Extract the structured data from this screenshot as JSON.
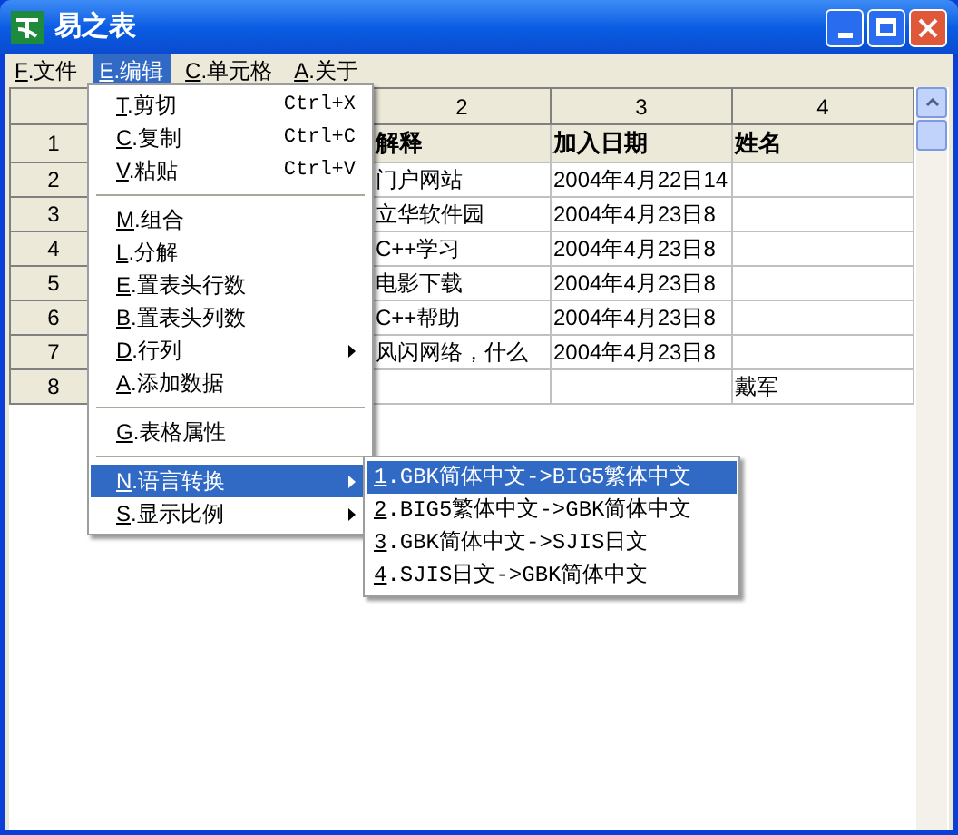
{
  "window": {
    "title": "易之表"
  },
  "menubar": [
    {
      "label": "F.文件",
      "selected": false
    },
    {
      "label": "E.编辑",
      "selected": true
    },
    {
      "label": "C.单元格",
      "selected": false
    },
    {
      "label": "A.关于",
      "selected": false
    }
  ],
  "grid": {
    "column_headers": [
      "2",
      "3",
      "4"
    ],
    "rows": [
      {
        "header": "1",
        "kind": "heading",
        "cells": [
          "解释",
          "加入日期",
          "姓名"
        ]
      },
      {
        "header": "2",
        "kind": "data",
        "cells": [
          "门户网站",
          "2004年4月22日14",
          null
        ]
      },
      {
        "header": "3",
        "kind": "data",
        "cells": [
          "立华软件园",
          "2004年4月23日8",
          null
        ]
      },
      {
        "header": "4",
        "kind": "data",
        "cells": [
          "C++学习",
          "2004年4月23日8",
          null
        ]
      },
      {
        "header": "5",
        "kind": "data",
        "cells": [
          "电影下载",
          "2004年4月23日8",
          null
        ]
      },
      {
        "header": "6",
        "kind": "data",
        "cells": [
          "C++帮助",
          "2004年4月23日8",
          null
        ]
      },
      {
        "header": "7",
        "kind": "data",
        "cells": [
          "风闪网络，什么",
          "2004年4月23日8",
          null
        ]
      },
      {
        "header": "8",
        "kind": "data",
        "cells": [
          null,
          null,
          "戴军"
        ]
      }
    ]
  },
  "edit_menu": [
    {
      "kind": "item",
      "label": "T.剪切",
      "shortcut": "Ctrl+X"
    },
    {
      "kind": "item",
      "label": "C.复制",
      "shortcut": "Ctrl+C"
    },
    {
      "kind": "item",
      "label": "V.粘贴",
      "shortcut": "Ctrl+V"
    },
    {
      "kind": "separator"
    },
    {
      "kind": "item",
      "label": "M.组合"
    },
    {
      "kind": "item",
      "label": "L.分解"
    },
    {
      "kind": "item",
      "label": "E.置表头行数"
    },
    {
      "kind": "item",
      "label": "B.置表头列数"
    },
    {
      "kind": "submenu",
      "label": "D.行列",
      "selected": false
    },
    {
      "kind": "item",
      "label": "A.添加数据"
    },
    {
      "kind": "separator"
    },
    {
      "kind": "item",
      "label": "G.表格属性"
    },
    {
      "kind": "separator"
    },
    {
      "kind": "submenu",
      "label": "N.语言转换",
      "selected": true,
      "expanded": true,
      "children": [
        {
          "label": "1.GBK简体中文->BIG5繁体中文",
          "selected": true
        },
        {
          "label": "2.BIG5繁体中文->GBK简体中文",
          "selected": false
        },
        {
          "label": "3.GBK简体中文->SJIS日文",
          "selected": false
        },
        {
          "label": "4.SJIS日文->GBK简体中文",
          "selected": false
        }
      ]
    },
    {
      "kind": "submenu",
      "label": "S.显示比例",
      "selected": false
    }
  ]
}
